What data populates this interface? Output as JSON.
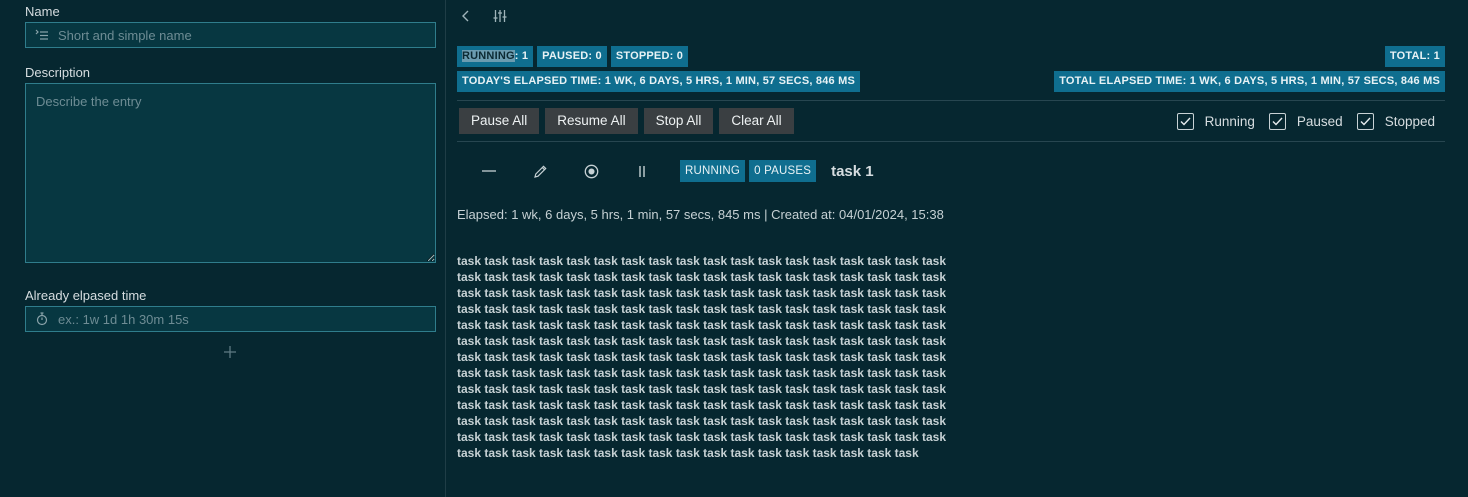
{
  "form": {
    "name_label": "Name",
    "name_placeholder": "Short and simple name",
    "description_label": "Description",
    "description_placeholder": "Describe the entry",
    "elapsed_label": "Already elpased time",
    "elapsed_placeholder": "ex.: 1w 1d 1h 30m 15s",
    "add_symbol": "+"
  },
  "stats": {
    "running_word": "RUNNING",
    "running_value": ": 1",
    "paused": "PAUSED: 0",
    "stopped": "STOPPED: 0",
    "total": "TOTAL: 1",
    "today_elapsed": "TODAY'S ELAPSED TIME: 1 WK, 6 DAYS, 5 HRS, 1 MIN, 57 SECS, 846 MS",
    "total_elapsed": "TOTAL ELAPSED TIME: 1 WK, 6 DAYS, 5 HRS, 1 MIN, 57 SECS, 846 MS"
  },
  "actions": {
    "pause_all": "Pause All",
    "resume_all": "Resume All",
    "stop_all": "Stop All",
    "clear_all": "Clear All"
  },
  "filters": [
    {
      "label": "Running",
      "checked": true
    },
    {
      "label": "Paused",
      "checked": true
    },
    {
      "label": "Stopped",
      "checked": true
    }
  ],
  "entry": {
    "status_badge": "RUNNING",
    "pauses_badge": "0 PAUSES",
    "title": "task 1",
    "meta": "Elapsed: 1 wk, 6 days, 5 hrs, 1 min, 57 secs, 845 ms | Created at: 04/01/2024, 15:38",
    "description": "task task task task task task task task task task task task task task task task task task task task task task task task task task task task task task task task task task task task task task task task task task task task task task task task task task task task task task task task task task task task task task task task task task task task task task task task task task task task task task task task task task task task task task task task task task task task task task task task task task task task task task task task task task task task task task task task task task task task task task task task task task task task task task task task task task task task task task task task task task task task task task task task task task task task task task task task task task task task task task task task task task task task task task task task task task task task task task task task task task task task task task task task task task task task task task task task task task task task task task task task task task task task task task task task task task task task task task task task task task task task task task task task task task task task task task task task task"
  },
  "icons": {
    "back": "chevron-left-icon",
    "settings": "sliders-icon",
    "name_field": "list-icon",
    "elapsed_field": "stopwatch-icon",
    "collapse": "minus-icon",
    "edit": "pencil-icon",
    "stop": "stop-circle-icon",
    "pause": "pause-icon"
  },
  "colors": {
    "background": "#062730",
    "badge": "#0f6e8f",
    "input_border": "#2f7d8c",
    "button": "#3a3f42"
  }
}
